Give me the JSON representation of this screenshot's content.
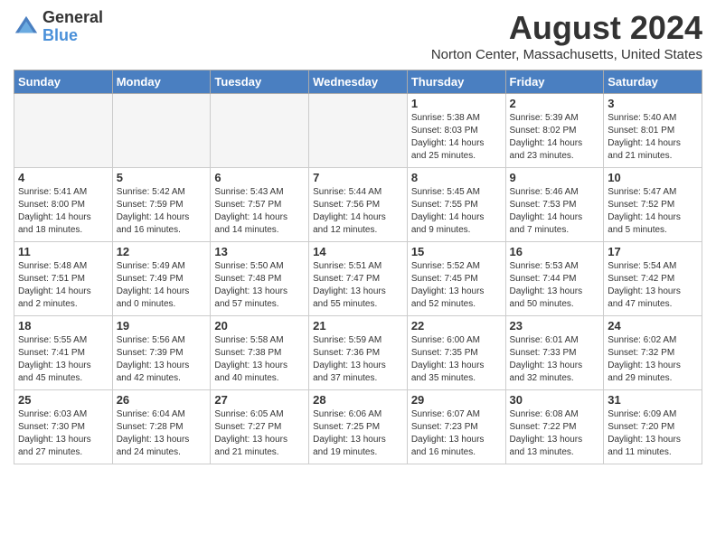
{
  "header": {
    "logo_line1": "General",
    "logo_line2": "Blue",
    "month": "August 2024",
    "location": "Norton Center, Massachusetts, United States"
  },
  "weekdays": [
    "Sunday",
    "Monday",
    "Tuesday",
    "Wednesday",
    "Thursday",
    "Friday",
    "Saturday"
  ],
  "weeks": [
    [
      {
        "day": "",
        "empty": true
      },
      {
        "day": "",
        "empty": true
      },
      {
        "day": "",
        "empty": true
      },
      {
        "day": "",
        "empty": true
      },
      {
        "day": "1",
        "sunrise": "5:38 AM",
        "sunset": "8:03 PM",
        "daylight": "14 hours and 25 minutes."
      },
      {
        "day": "2",
        "sunrise": "5:39 AM",
        "sunset": "8:02 PM",
        "daylight": "14 hours and 23 minutes."
      },
      {
        "day": "3",
        "sunrise": "5:40 AM",
        "sunset": "8:01 PM",
        "daylight": "14 hours and 21 minutes."
      }
    ],
    [
      {
        "day": "4",
        "sunrise": "5:41 AM",
        "sunset": "8:00 PM",
        "daylight": "14 hours and 18 minutes."
      },
      {
        "day": "5",
        "sunrise": "5:42 AM",
        "sunset": "7:59 PM",
        "daylight": "14 hours and 16 minutes."
      },
      {
        "day": "6",
        "sunrise": "5:43 AM",
        "sunset": "7:57 PM",
        "daylight": "14 hours and 14 minutes."
      },
      {
        "day": "7",
        "sunrise": "5:44 AM",
        "sunset": "7:56 PM",
        "daylight": "14 hours and 12 minutes."
      },
      {
        "day": "8",
        "sunrise": "5:45 AM",
        "sunset": "7:55 PM",
        "daylight": "14 hours and 9 minutes."
      },
      {
        "day": "9",
        "sunrise": "5:46 AM",
        "sunset": "7:53 PM",
        "daylight": "14 hours and 7 minutes."
      },
      {
        "day": "10",
        "sunrise": "5:47 AM",
        "sunset": "7:52 PM",
        "daylight": "14 hours and 5 minutes."
      }
    ],
    [
      {
        "day": "11",
        "sunrise": "5:48 AM",
        "sunset": "7:51 PM",
        "daylight": "14 hours and 2 minutes."
      },
      {
        "day": "12",
        "sunrise": "5:49 AM",
        "sunset": "7:49 PM",
        "daylight": "14 hours and 0 minutes."
      },
      {
        "day": "13",
        "sunrise": "5:50 AM",
        "sunset": "7:48 PM",
        "daylight": "13 hours and 57 minutes."
      },
      {
        "day": "14",
        "sunrise": "5:51 AM",
        "sunset": "7:47 PM",
        "daylight": "13 hours and 55 minutes."
      },
      {
        "day": "15",
        "sunrise": "5:52 AM",
        "sunset": "7:45 PM",
        "daylight": "13 hours and 52 minutes."
      },
      {
        "day": "16",
        "sunrise": "5:53 AM",
        "sunset": "7:44 PM",
        "daylight": "13 hours and 50 minutes."
      },
      {
        "day": "17",
        "sunrise": "5:54 AM",
        "sunset": "7:42 PM",
        "daylight": "13 hours and 47 minutes."
      }
    ],
    [
      {
        "day": "18",
        "sunrise": "5:55 AM",
        "sunset": "7:41 PM",
        "daylight": "13 hours and 45 minutes."
      },
      {
        "day": "19",
        "sunrise": "5:56 AM",
        "sunset": "7:39 PM",
        "daylight": "13 hours and 42 minutes."
      },
      {
        "day": "20",
        "sunrise": "5:58 AM",
        "sunset": "7:38 PM",
        "daylight": "13 hours and 40 minutes."
      },
      {
        "day": "21",
        "sunrise": "5:59 AM",
        "sunset": "7:36 PM",
        "daylight": "13 hours and 37 minutes."
      },
      {
        "day": "22",
        "sunrise": "6:00 AM",
        "sunset": "7:35 PM",
        "daylight": "13 hours and 35 minutes."
      },
      {
        "day": "23",
        "sunrise": "6:01 AM",
        "sunset": "7:33 PM",
        "daylight": "13 hours and 32 minutes."
      },
      {
        "day": "24",
        "sunrise": "6:02 AM",
        "sunset": "7:32 PM",
        "daylight": "13 hours and 29 minutes."
      }
    ],
    [
      {
        "day": "25",
        "sunrise": "6:03 AM",
        "sunset": "7:30 PM",
        "daylight": "13 hours and 27 minutes."
      },
      {
        "day": "26",
        "sunrise": "6:04 AM",
        "sunset": "7:28 PM",
        "daylight": "13 hours and 24 minutes."
      },
      {
        "day": "27",
        "sunrise": "6:05 AM",
        "sunset": "7:27 PM",
        "daylight": "13 hours and 21 minutes."
      },
      {
        "day": "28",
        "sunrise": "6:06 AM",
        "sunset": "7:25 PM",
        "daylight": "13 hours and 19 minutes."
      },
      {
        "day": "29",
        "sunrise": "6:07 AM",
        "sunset": "7:23 PM",
        "daylight": "13 hours and 16 minutes."
      },
      {
        "day": "30",
        "sunrise": "6:08 AM",
        "sunset": "7:22 PM",
        "daylight": "13 hours and 13 minutes."
      },
      {
        "day": "31",
        "sunrise": "6:09 AM",
        "sunset": "7:20 PM",
        "daylight": "13 hours and 11 minutes."
      }
    ]
  ]
}
